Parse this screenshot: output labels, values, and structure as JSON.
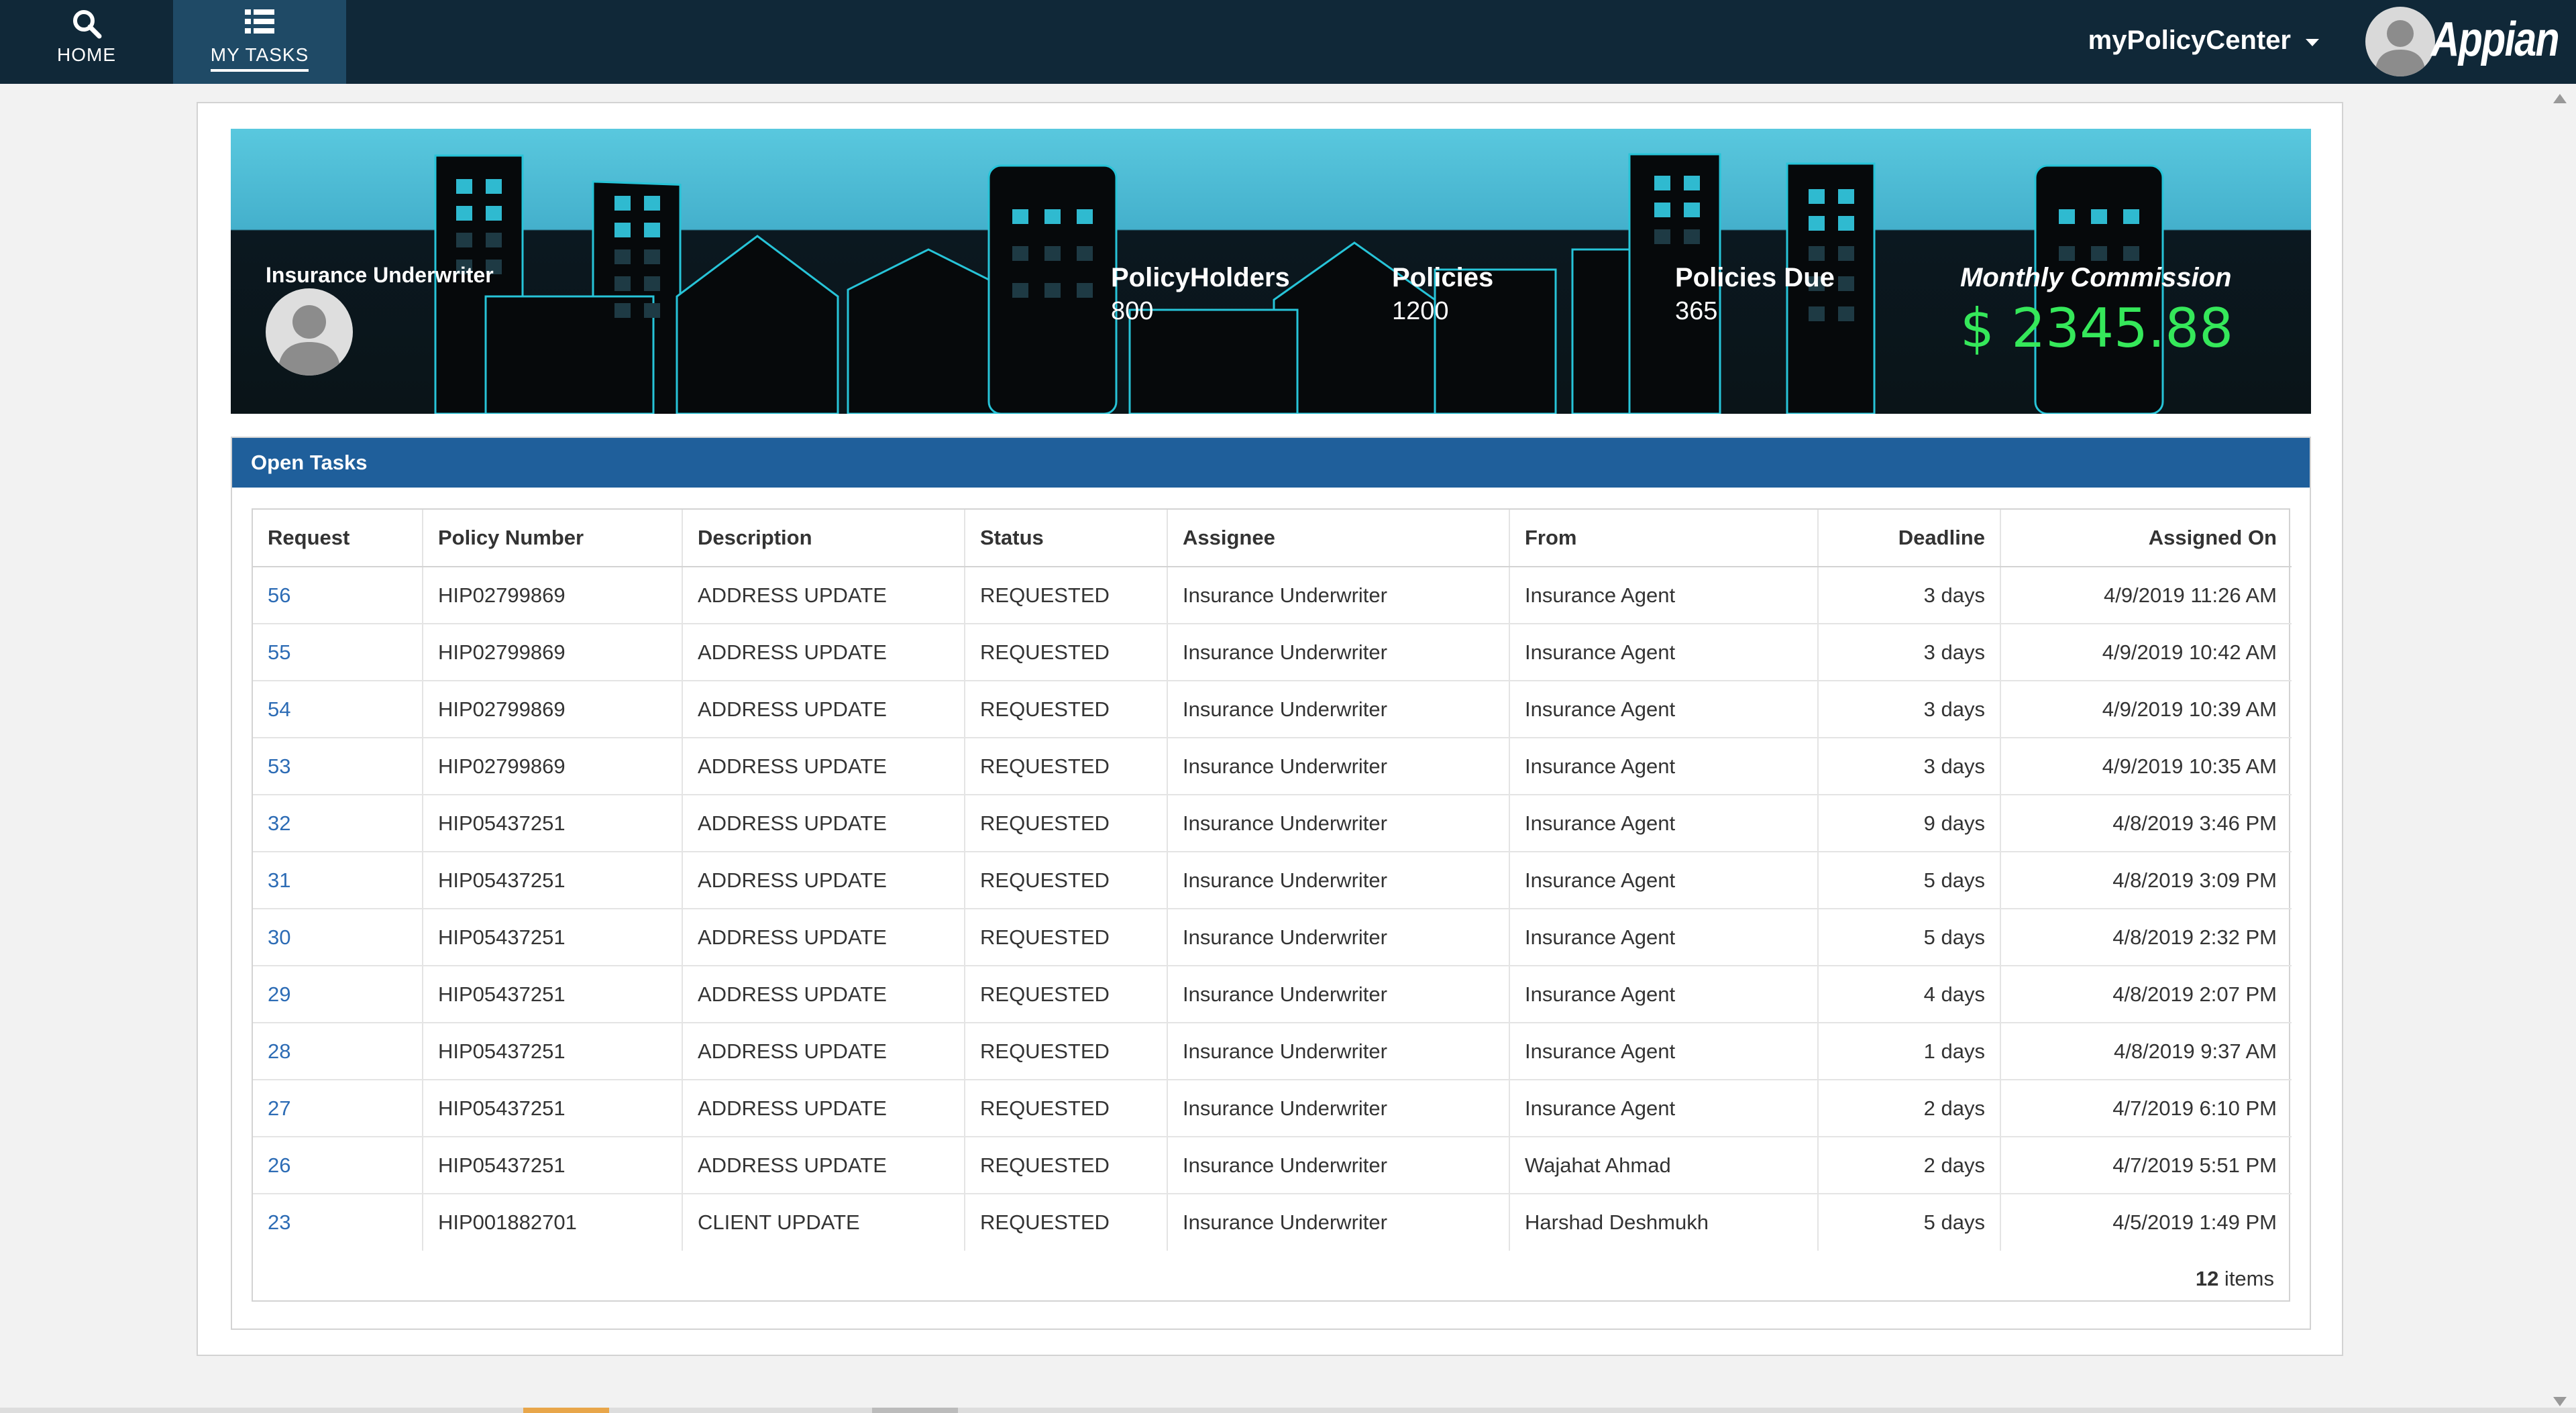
{
  "nav": {
    "home_label": "HOME",
    "tasks_label": "MY TASKS",
    "site_name": "myPolicyCenter",
    "logo_text": "Appian"
  },
  "banner": {
    "role": "Insurance Underwriter",
    "policyholders_label": "PolicyHolders",
    "policyholders_value": "800",
    "policies_label": "Policies",
    "policies_value": "1200",
    "policies_due_label": "Policies Due",
    "policies_due_value": "365",
    "commission_label": "Monthly Commission",
    "commission_value": "$ 2345.88"
  },
  "tasks": {
    "title": "Open Tasks",
    "columns": [
      "Request",
      "Policy Number",
      "Description",
      "Status",
      "Assignee",
      "From",
      "Deadline",
      "Assigned On"
    ],
    "rows": [
      [
        "56",
        "HIP02799869",
        "ADDRESS UPDATE",
        "REQUESTED",
        "Insurance Underwriter",
        "Insurance Agent",
        "3 days",
        "4/9/2019 11:26 AM"
      ],
      [
        "55",
        "HIP02799869",
        "ADDRESS UPDATE",
        "REQUESTED",
        "Insurance Underwriter",
        "Insurance Agent",
        "3 days",
        "4/9/2019 10:42 AM"
      ],
      [
        "54",
        "HIP02799869",
        "ADDRESS UPDATE",
        "REQUESTED",
        "Insurance Underwriter",
        "Insurance Agent",
        "3 days",
        "4/9/2019 10:39 AM"
      ],
      [
        "53",
        "HIP02799869",
        "ADDRESS UPDATE",
        "REQUESTED",
        "Insurance Underwriter",
        "Insurance Agent",
        "3 days",
        "4/9/2019 10:35 AM"
      ],
      [
        "32",
        "HIP05437251",
        "ADDRESS UPDATE",
        "REQUESTED",
        "Insurance Underwriter",
        "Insurance Agent",
        "9 days",
        "4/8/2019 3:46 PM"
      ],
      [
        "31",
        "HIP05437251",
        "ADDRESS UPDATE",
        "REQUESTED",
        "Insurance Underwriter",
        "Insurance Agent",
        "5 days",
        "4/8/2019 3:09 PM"
      ],
      [
        "30",
        "HIP05437251",
        "ADDRESS UPDATE",
        "REQUESTED",
        "Insurance Underwriter",
        "Insurance Agent",
        "5 days",
        "4/8/2019 2:32 PM"
      ],
      [
        "29",
        "HIP05437251",
        "ADDRESS UPDATE",
        "REQUESTED",
        "Insurance Underwriter",
        "Insurance Agent",
        "4 days",
        "4/8/2019 2:07 PM"
      ],
      [
        "28",
        "HIP05437251",
        "ADDRESS UPDATE",
        "REQUESTED",
        "Insurance Underwriter",
        "Insurance Agent",
        "1 days",
        "4/8/2019 9:37 AM"
      ],
      [
        "27",
        "HIP05437251",
        "ADDRESS UPDATE",
        "REQUESTED",
        "Insurance Underwriter",
        "Insurance Agent",
        "2 days",
        "4/7/2019 6:10 PM"
      ],
      [
        "26",
        "HIP05437251",
        "ADDRESS UPDATE",
        "REQUESTED",
        "Insurance Underwriter",
        "Wajahat Ahmad",
        "2 days",
        "4/7/2019 5:51 PM"
      ],
      [
        "23",
        "HIP001882701",
        "CLIENT UPDATE",
        "REQUESTED",
        "Insurance Underwriter",
        "Harshad Deshmukh",
        "5 days",
        "4/5/2019 1:49 PM"
      ]
    ],
    "count": "12",
    "count_suffix": " items"
  },
  "colors": {
    "topbar": "#102838",
    "header_blue": "#1f5f9b",
    "link": "#2d6cb5",
    "commission_green": "#35e85a"
  },
  "icons": {
    "home": "search-icon",
    "tasks": "list-icon",
    "dropdown": "caret-down-icon",
    "user": "user-avatar-icon"
  }
}
